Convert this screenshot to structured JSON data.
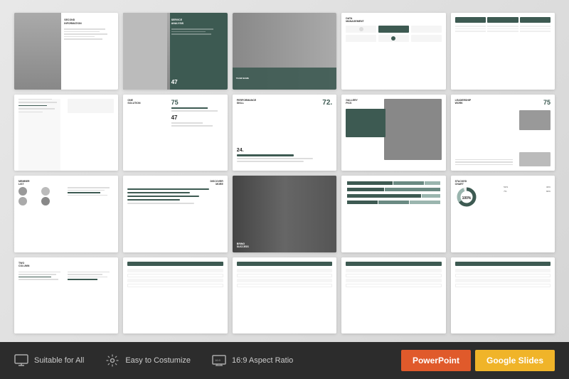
{
  "slides": [
    {
      "id": "s1",
      "type": "photo-left-text",
      "label": "SECOND INFORMATION"
    },
    {
      "id": "s2",
      "type": "photo-left-teal-right",
      "label": "SERVICE ANALYSIS"
    },
    {
      "id": "s3",
      "type": "full-photo-band",
      "label": ""
    },
    {
      "id": "s4",
      "type": "data-grid",
      "label": "DATA MANAGEMENT"
    },
    {
      "id": "s5",
      "type": "data-columns",
      "label": ""
    },
    {
      "id": "s6",
      "type": "lines-text",
      "label": ""
    },
    {
      "id": "s7",
      "type": "text-numbers",
      "label": "ONE SOLUTION"
    },
    {
      "id": "s8",
      "type": "perf-skill",
      "label": "PERFORMANCE SKILL"
    },
    {
      "id": "s9",
      "type": "gallery",
      "label": "GALLERY PICS"
    },
    {
      "id": "s10",
      "type": "leadership",
      "label": "LEADERSHIP WORK"
    },
    {
      "id": "s11",
      "type": "member-photo",
      "label": "MEMBER LIST"
    },
    {
      "id": "s12",
      "type": "lines-only",
      "label": "DISCOVER MORE"
    },
    {
      "id": "s13",
      "type": "photo-dark",
      "label": "BRING SUCCESS"
    },
    {
      "id": "s14",
      "type": "stacked-bars",
      "label": ""
    },
    {
      "id": "s15",
      "type": "stacked-chart",
      "label": "STACKED CHART"
    },
    {
      "id": "s16",
      "type": "two-column",
      "label": "TWO COLUMN"
    },
    {
      "id": "s17",
      "type": "table-rows",
      "label": ""
    },
    {
      "id": "s18",
      "type": "table-rows2",
      "label": ""
    },
    {
      "id": "s19",
      "type": "table-rows3",
      "label": ""
    }
  ],
  "features": [
    {
      "icon": "monitor-icon",
      "label": "Suitable for All"
    },
    {
      "icon": "settings-icon",
      "label": "Easy to Costumize"
    },
    {
      "icon": "screen-icon",
      "label": "16:9 Aspect Ratio"
    }
  ],
  "buttons": {
    "powerpoint": "PowerPoint",
    "google": "Google Slides"
  }
}
